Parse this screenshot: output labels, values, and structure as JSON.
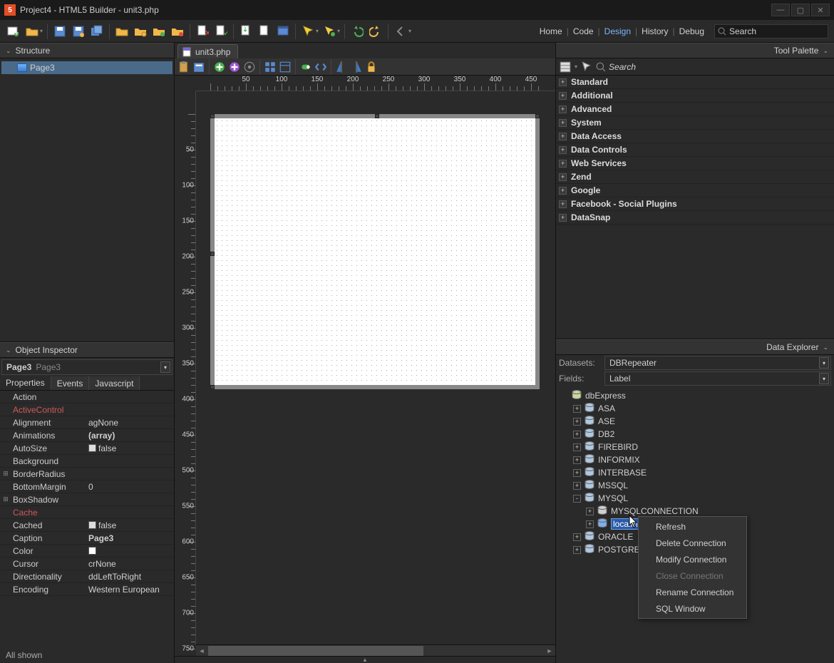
{
  "title": "Project4 - HTML5 Builder - unit3.php",
  "nav": {
    "home": "Home",
    "code": "Code",
    "design": "Design",
    "history": "History",
    "debug": "Debug"
  },
  "search_placeholder": "Search",
  "structure": {
    "title": "Structure",
    "root": "Page3"
  },
  "inspector": {
    "title": "Object Inspector",
    "selected": "Page3",
    "selected_type": "Page3",
    "tabs": {
      "properties": "Properties",
      "events": "Events",
      "javascript": "Javascript"
    },
    "rows": [
      {
        "k": "Action",
        "v": ""
      },
      {
        "k": "ActiveControl",
        "v": "",
        "red": true
      },
      {
        "k": "Alignment",
        "v": "agNone"
      },
      {
        "k": "Animations",
        "v": "(array)",
        "bold": true
      },
      {
        "k": "AutoSize",
        "v": "false",
        "check": true
      },
      {
        "k": "Background",
        "v": ""
      },
      {
        "k": "BorderRadius",
        "v": "",
        "exp": true
      },
      {
        "k": "BottomMargin",
        "v": "0"
      },
      {
        "k": "BoxShadow",
        "v": "",
        "exp": true
      },
      {
        "k": "Cache",
        "v": "",
        "red": true
      },
      {
        "k": "Cached",
        "v": "false",
        "check": true
      },
      {
        "k": "Caption",
        "v": "Page3",
        "bold": true
      },
      {
        "k": "Color",
        "v": "",
        "swatch": true
      },
      {
        "k": "Cursor",
        "v": "crNone"
      },
      {
        "k": "Directionality",
        "v": "ddLeftToRight"
      },
      {
        "k": "Encoding",
        "v": "Western European"
      }
    ],
    "status": "All shown"
  },
  "file_tab": "unit3.php",
  "palette": {
    "title": "Tool Palette",
    "search": "Search",
    "cats": [
      "Standard",
      "Additional",
      "Advanced",
      "System",
      "Data Access",
      "Data Controls",
      "Web Services",
      "Zend",
      "Google",
      "Facebook - Social Plugins",
      "DataSnap"
    ]
  },
  "data_explorer": {
    "title": "Data Explorer",
    "datasets_label": "Datasets:",
    "datasets_value": "DBRepeater",
    "fields_label": "Fields:",
    "fields_value": "Label",
    "root": "dbExpress",
    "providers": [
      "ASA",
      "ASE",
      "DB2",
      "FIREBIRD",
      "INFORMIX",
      "INTERBASE",
      "MSSQL"
    ],
    "mysql": {
      "label": "MYSQL",
      "conn": "MYSQLCONNECTION",
      "local": "localmysql"
    },
    "tail": [
      "ORACLE",
      "POSTGRESQL"
    ]
  },
  "context_menu": {
    "refresh": "Refresh",
    "delete": "Delete Connection",
    "modify": "Modify Connection",
    "close": "Close Connection",
    "rename": "Rename Connection",
    "sql": "SQL Window"
  }
}
